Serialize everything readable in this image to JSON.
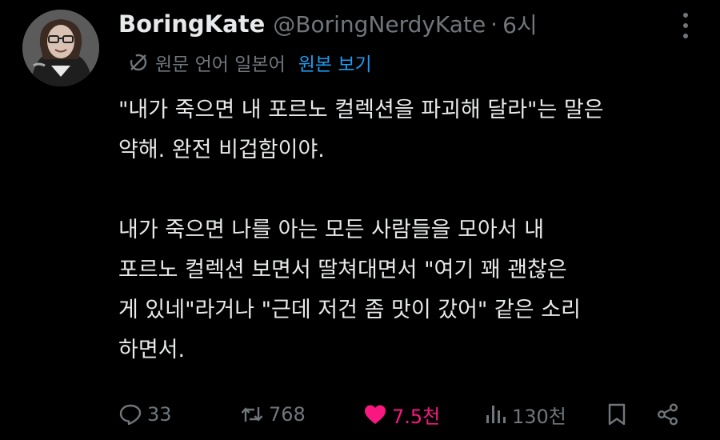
{
  "author": {
    "display_name": "BoringKate",
    "handle": "@BoringNerdyKate",
    "separator": "·",
    "time": "6시"
  },
  "translation": {
    "label": "원문 언어 일본어",
    "show_original": "원본 보기"
  },
  "body": {
    "lines": [
      "\"내가 죽으면 내 포르노 컬렉션을 파괴해 달라\"는 말은",
      "약해. 완전 비겁함이야.",
      "",
      "내가 죽으면 나를 아는 모든 사람들을 모아서 내",
      "포르노 컬렉션 보면서 딸쳐대면서 \"여기 꽤 괜찮은",
      "게 있네\"라거나 \"근데 저건 좀 맛이 갔어\" 같은 소리",
      "하면서."
    ]
  },
  "actions": {
    "reply": {
      "icon": "reply-icon",
      "count": "33"
    },
    "repost": {
      "icon": "repost-icon",
      "count": "768"
    },
    "like": {
      "icon": "heart-filled-icon",
      "count": "7.5천",
      "active": true,
      "color": "#f91880"
    },
    "views": {
      "icon": "views-icon",
      "count": "130천"
    },
    "bookmark": {
      "icon": "bookmark-icon"
    },
    "share": {
      "icon": "share-icon"
    }
  },
  "colors": {
    "background": "#000000",
    "text": "#e7e9ea",
    "muted": "#71767b",
    "link": "#1d9bf0",
    "like": "#f91880"
  }
}
